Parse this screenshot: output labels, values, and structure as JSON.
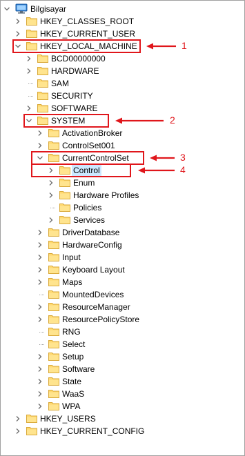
{
  "root": {
    "label": "Bilgisayar"
  },
  "tree": [
    {
      "label": "HKEY_CLASSES_ROOT",
      "depth": 1,
      "expander": "collapsed"
    },
    {
      "label": "HKEY_CURRENT_USER",
      "depth": 1,
      "expander": "collapsed"
    },
    {
      "label": "HKEY_LOCAL_MACHINE",
      "depth": 1,
      "expander": "expanded"
    },
    {
      "label": "BCD00000000",
      "depth": 2,
      "expander": "collapsed"
    },
    {
      "label": "HARDWARE",
      "depth": 2,
      "expander": "collapsed"
    },
    {
      "label": "SAM",
      "depth": 2,
      "expander": "none"
    },
    {
      "label": "SECURITY",
      "depth": 2,
      "expander": "none"
    },
    {
      "label": "SOFTWARE",
      "depth": 2,
      "expander": "collapsed"
    },
    {
      "label": "SYSTEM",
      "depth": 2,
      "expander": "expanded"
    },
    {
      "label": "ActivationBroker",
      "depth": 3,
      "expander": "collapsed"
    },
    {
      "label": "ControlSet001",
      "depth": 3,
      "expander": "collapsed"
    },
    {
      "label": "CurrentControlSet",
      "depth": 3,
      "expander": "expanded"
    },
    {
      "label": "Control",
      "depth": 4,
      "expander": "collapsed",
      "selected": true
    },
    {
      "label": "Enum",
      "depth": 4,
      "expander": "collapsed"
    },
    {
      "label": "Hardware Profiles",
      "depth": 4,
      "expander": "collapsed"
    },
    {
      "label": "Policies",
      "depth": 4,
      "expander": "none"
    },
    {
      "label": "Services",
      "depth": 4,
      "expander": "collapsed"
    },
    {
      "label": "DriverDatabase",
      "depth": 3,
      "expander": "collapsed"
    },
    {
      "label": "HardwareConfig",
      "depth": 3,
      "expander": "collapsed"
    },
    {
      "label": "Input",
      "depth": 3,
      "expander": "collapsed"
    },
    {
      "label": "Keyboard Layout",
      "depth": 3,
      "expander": "collapsed"
    },
    {
      "label": "Maps",
      "depth": 3,
      "expander": "collapsed"
    },
    {
      "label": "MountedDevices",
      "depth": 3,
      "expander": "none"
    },
    {
      "label": "ResourceManager",
      "depth": 3,
      "expander": "collapsed"
    },
    {
      "label": "ResourcePolicyStore",
      "depth": 3,
      "expander": "collapsed"
    },
    {
      "label": "RNG",
      "depth": 3,
      "expander": "none"
    },
    {
      "label": "Select",
      "depth": 3,
      "expander": "none"
    },
    {
      "label": "Setup",
      "depth": 3,
      "expander": "collapsed"
    },
    {
      "label": "Software",
      "depth": 3,
      "expander": "collapsed"
    },
    {
      "label": "State",
      "depth": 3,
      "expander": "collapsed"
    },
    {
      "label": "WaaS",
      "depth": 3,
      "expander": "collapsed"
    },
    {
      "label": "WPA",
      "depth": 3,
      "expander": "collapsed"
    },
    {
      "label": "HKEY_USERS",
      "depth": 1,
      "expander": "collapsed"
    },
    {
      "label": "HKEY_CURRENT_CONFIG",
      "depth": 1,
      "expander": "collapsed"
    }
  ],
  "annotations": [
    {
      "number": "1",
      "row_label": "HKEY_LOCAL_MACHINE"
    },
    {
      "number": "2",
      "row_label": "SYSTEM"
    },
    {
      "number": "3",
      "row_label": "CurrentControlSet"
    },
    {
      "number": "4",
      "row_label": "Control"
    }
  ],
  "colors": {
    "highlight": "#e0161b",
    "selection": "#cce8ff",
    "folder_fill": "#ffd970",
    "folder_edge": "#d9a93a",
    "chevron": "#6b6b6b",
    "dotted_line": "#a0a0a0"
  },
  "icons": {
    "computer": "computer-icon",
    "folder": "folder-icon",
    "expanded": "chevron-down-icon",
    "collapsed": "chevron-right-icon"
  }
}
